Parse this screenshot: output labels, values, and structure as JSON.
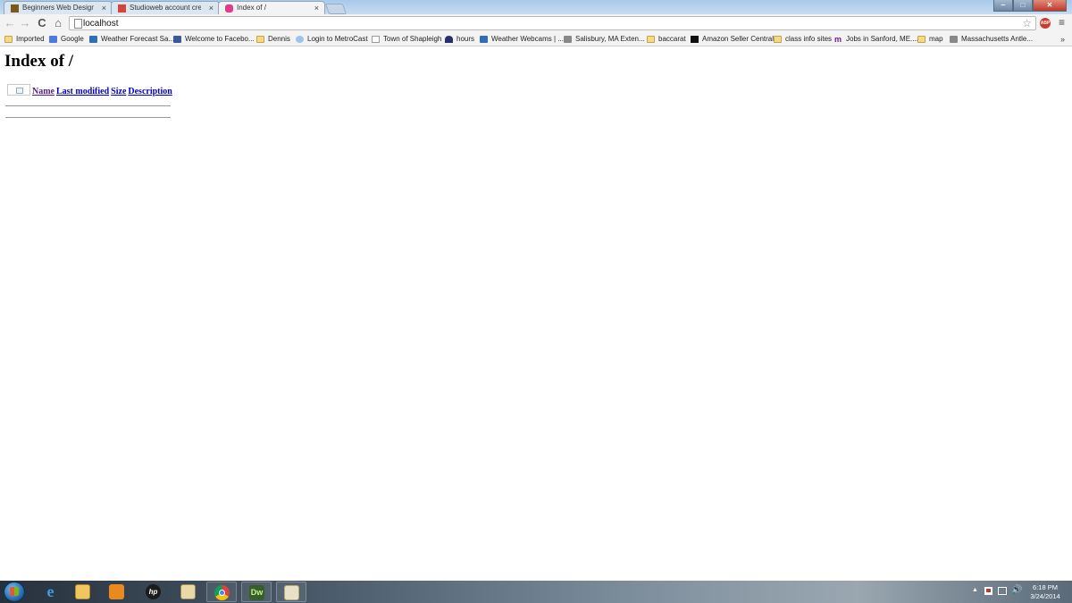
{
  "tabs": [
    {
      "title": "Beginners Web Design - l",
      "close": "×"
    },
    {
      "title": "Studioweb account create",
      "close": "×"
    },
    {
      "title": "Index of /",
      "close": "×"
    }
  ],
  "window_controls": {
    "minimize": "‒",
    "maximize": "□",
    "close": "✕"
  },
  "toolbar": {
    "back": "←",
    "forward": "→",
    "reload": "C",
    "home": "⌂",
    "url": "localhost",
    "star": "☆",
    "adblock": "ABP",
    "menu": "≡"
  },
  "bookmarks": [
    {
      "label": "Imported",
      "icon": "folder"
    },
    {
      "label": "Google",
      "icon": "google"
    },
    {
      "label": "Weather Forecast Sa...",
      "icon": "blue"
    },
    {
      "label": "Welcome to Facebo...",
      "icon": "fb"
    },
    {
      "label": "Dennis",
      "icon": "folder"
    },
    {
      "label": "Login to MetroCast",
      "icon": "mail"
    },
    {
      "label": "Town of Shapleigh",
      "icon": "doc"
    },
    {
      "label": "hours",
      "icon": "dark"
    },
    {
      "label": "Weather Webcams | ...",
      "icon": "blue"
    },
    {
      "label": "Salisbury, MA Exten...",
      "icon": "gray"
    },
    {
      "label": "baccarat",
      "icon": "folder"
    },
    {
      "label": "Amazon Seller Central",
      "icon": "amazon"
    },
    {
      "label": "class info sites",
      "icon": "folder"
    },
    {
      "label": "Jobs in Sanford, ME....",
      "icon": "monster"
    },
    {
      "label": "map",
      "icon": "folder"
    },
    {
      "label": "Massachusetts Antle...",
      "icon": "gray"
    }
  ],
  "bookmarks_overflow": "»",
  "page": {
    "heading": "Index of /",
    "columns": {
      "name": "Name",
      "last_modified": "Last modified",
      "size": "Size",
      "description": "Description"
    }
  },
  "taskbar": {
    "ie_glyph": "e",
    "hp_glyph": "hp",
    "dw_glyph": "Dw",
    "clock_time": "6:18 PM",
    "clock_date": "3/24/2014",
    "tray_arrow": "▲",
    "volume": "🔊"
  }
}
